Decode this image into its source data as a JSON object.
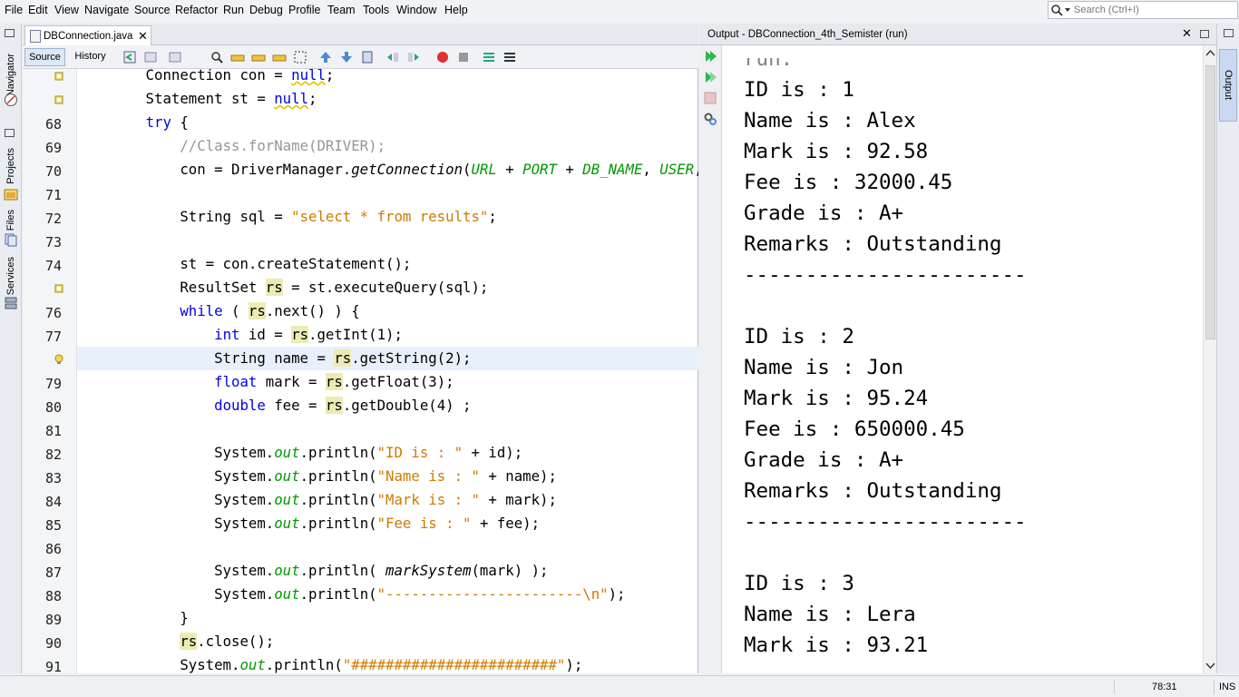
{
  "menu": [
    "File",
    "Edit",
    "View",
    "Navigate",
    "Source",
    "Refactor",
    "Run",
    "Debug",
    "Profile",
    "Team",
    "Tools",
    "Window",
    "Help"
  ],
  "search": {
    "placeholder": "Search (Ctrl+I)"
  },
  "side_tabs_left": [
    "Navigator",
    "Projects",
    "Files",
    "Services"
  ],
  "editor": {
    "tab_label": "DBConnection.java",
    "source_label": "Source",
    "history_label": "History",
    "line_numbers": [
      "",
      "",
      "68",
      "69",
      "70",
      "71",
      "72",
      "73",
      "74",
      "",
      "76",
      "77",
      "",
      "79",
      "80",
      "81",
      "82",
      "83",
      "84",
      "85",
      "86",
      "87",
      "88",
      "89",
      "90",
      "91"
    ]
  },
  "output": {
    "title": "Output - DBConnection_4th_Semister (run)",
    "lines": [
      "run:",
      "ID is : 1",
      "Name is : Alex",
      "Mark is : 92.58",
      "Fee is : 32000.45",
      "Grade is : A+",
      "Remarks : Outstanding",
      "-----------------------",
      "",
      "ID is : 2",
      "Name is : Jon",
      "Mark is : 95.24",
      "Fee is : 650000.45",
      "Grade is : A+",
      "Remarks : Outstanding",
      "-----------------------",
      "",
      "ID is : 3",
      "Name is : Lera",
      "Mark is : 93.21"
    ]
  },
  "right_tab": "Output",
  "status": {
    "position": "78:31",
    "mode": "INS"
  }
}
